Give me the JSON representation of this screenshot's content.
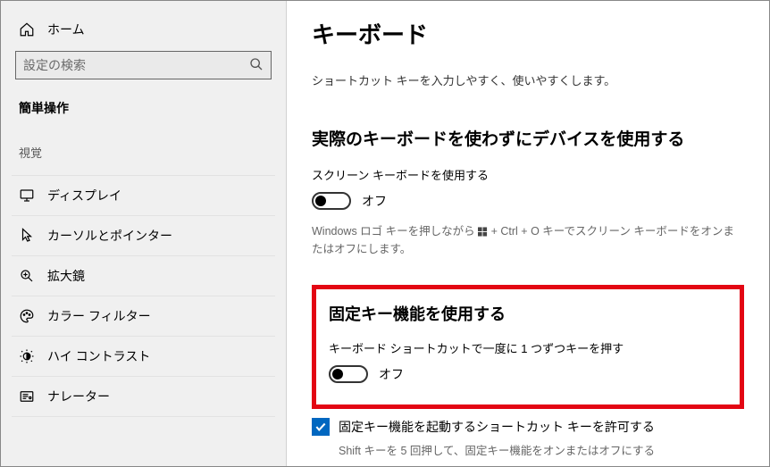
{
  "sidebar": {
    "home_label": "ホーム",
    "search_placeholder": "設定の検索",
    "category": "簡単操作",
    "section_label": "視覚",
    "items": [
      {
        "label": "ディスプレイ"
      },
      {
        "label": "カーソルとポインター"
      },
      {
        "label": "拡大鏡"
      },
      {
        "label": "カラー フィルター"
      },
      {
        "label": "ハイ コントラスト"
      },
      {
        "label": "ナレーター"
      }
    ]
  },
  "content": {
    "title": "キーボード",
    "desc": "ショートカット キーを入力しやすく、使いやすくします。",
    "section1": {
      "title": "実際のキーボードを使わずにデバイスを使用する",
      "toggle_label": "スクリーン キーボードを使用する",
      "toggle_state": "オフ",
      "hint_pre": "Windows ロゴ キーを押しながら ",
      "hint_post": " + Ctrl + O キーでスクリーン キーボードをオンまたはオフにします。"
    },
    "section2": {
      "title": "固定キー機能を使用する",
      "toggle_label": "キーボード ショートカットで一度に 1 つずつキーを押す",
      "toggle_state": "オフ"
    },
    "checkbox_label": "固定キー機能を起動するショートカット キーを許可する",
    "checkbox_hint": "Shift キーを 5 回押して、固定キー機能をオンまたはオフにする"
  }
}
